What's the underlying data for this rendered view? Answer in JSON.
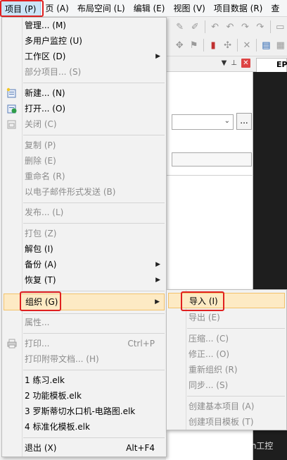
{
  "menubar": {
    "items": [
      "项目 (P)",
      "页 (A)",
      "布局空间 (L)",
      "编辑 (E)",
      "视图 (V)",
      "项目数据 (R)",
      "查"
    ]
  },
  "panel": {
    "tab_label": "EP",
    "dots_label": "..."
  },
  "menu": {
    "items": [
      {
        "label": "管理... (M)",
        "disabled": false
      },
      {
        "label": "多用户监控 (U)",
        "disabled": false
      },
      {
        "label": "工作区 (D)",
        "disabled": false,
        "submenu": true
      },
      {
        "label": "部分项目... (S)",
        "disabled": true
      },
      {
        "label": "新建... (N)",
        "disabled": false,
        "icon": "new-project-icon"
      },
      {
        "label": "打开... (O)",
        "disabled": false,
        "icon": "open-project-icon"
      },
      {
        "label": "关闭 (C)",
        "disabled": true,
        "icon": "close-project-icon"
      },
      {
        "label": "复制 (P)",
        "disabled": true
      },
      {
        "label": "删除 (E)",
        "disabled": true
      },
      {
        "label": "重命名 (R)",
        "disabled": true
      },
      {
        "label": "以电子邮件形式发送 (B)",
        "disabled": true
      },
      {
        "label": "发布... (L)",
        "disabled": true
      },
      {
        "label": "打包 (Z)",
        "disabled": true
      },
      {
        "label": "解包 (I)",
        "disabled": false
      },
      {
        "label": "备份 (A)",
        "disabled": false,
        "submenu": true
      },
      {
        "label": "恢复 (T)",
        "disabled": false,
        "submenu": true
      },
      {
        "label": "组织 (G)",
        "disabled": false,
        "submenu": true,
        "highlighted": true
      },
      {
        "label": "属性...",
        "disabled": true
      },
      {
        "label": "打印...",
        "disabled": true,
        "shortcut": "Ctrl+P",
        "icon": "printer-icon"
      },
      {
        "label": "打印附带文档... (H)",
        "disabled": true
      },
      {
        "label": "1 练习.elk",
        "disabled": false
      },
      {
        "label": "2 功能模板.elk",
        "disabled": false
      },
      {
        "label": "3 罗斯蒂切水口机-电路图.elk",
        "disabled": false
      },
      {
        "label": "4 标准化模板.elk",
        "disabled": false
      },
      {
        "label": "退出 (X)",
        "disabled": false,
        "shortcut": "Alt+F4"
      }
    ]
  },
  "submenu": {
    "items": [
      {
        "label": "导入 (I)",
        "disabled": false,
        "highlighted": true
      },
      {
        "label": "导出 (E)",
        "disabled": true
      },
      {
        "label": "压缩... (C)",
        "disabled": true
      },
      {
        "label": "修正... (O)",
        "disabled": true
      },
      {
        "label": "重新组织 (R)",
        "disabled": true
      },
      {
        "label": "同步... (S)",
        "disabled": true
      },
      {
        "label": "创建基本项目 (A)",
        "disabled": true
      },
      {
        "label": "创建项目模板 (T)",
        "disabled": true
      }
    ]
  },
  "watermark": "知乎 @Kan工控",
  "colors": {
    "highlight_border": "#e02020",
    "hover_fill": "#fdeac4",
    "disabled_text": "#8c8c8c"
  }
}
